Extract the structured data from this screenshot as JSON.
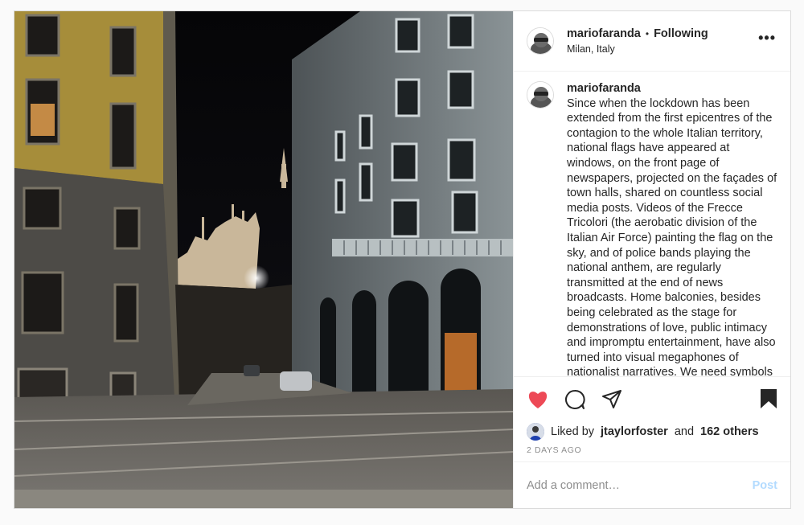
{
  "post": {
    "username": "mariofaranda",
    "separator": "•",
    "follow_status": "Following",
    "location": "Milan, Italy",
    "more_icon": "ellipsis-icon"
  },
  "caption": {
    "username": "mariofaranda",
    "text": "Since when the lockdown has been extended from the first epicentres of the contagion to the whole Italian territory, national flags have appeared at windows, on the front page of newspapers, projected on the façades of town halls, shared on countless social media posts. Videos of the Frecce Tricolori (the aerobatic division of the Italian Air Force) painting the flag on the sky, and of police bands playing the national anthem, are regularly transmitted at the end of news broadcasts. Home balconies, besides being celebrated as the stage for demonstrations of love, public intimacy and impromptu entertainment, have also turned into visual megaphones of nationalist narratives. We need symbols"
  },
  "actions": {
    "like_icon": "heart-icon",
    "like_color": "#ed4956",
    "comment_icon": "comment-icon",
    "share_icon": "share-icon",
    "save_icon": "bookmark-icon"
  },
  "likes": {
    "prefix": "Liked by",
    "user": "jtaylorfoster",
    "conjunction": "and",
    "others": "162 others"
  },
  "timestamp": "2 DAYS AGO",
  "comment_box": {
    "placeholder": "Add a comment…",
    "post_label": "Post",
    "post_color": "#b3dbff"
  }
}
